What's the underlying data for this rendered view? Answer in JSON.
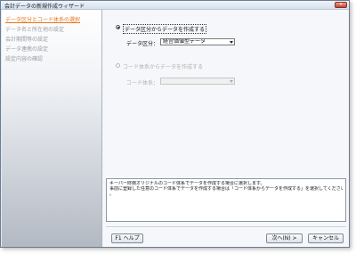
{
  "window": {
    "title": "会計データの新規作成ウィザード",
    "close_label": "×"
  },
  "sidebar": {
    "steps": [
      {
        "label": "データ区分とコード体系の選択"
      },
      {
        "label": "データ名と所在地の設定"
      },
      {
        "label": "会計期間等の設定"
      },
      {
        "label": "データ連携の設定"
      },
      {
        "label": "設定内容の確認"
      }
    ]
  },
  "main": {
    "option1": {
      "label": "データ区分からデータを作成する",
      "selected": true
    },
    "data_kind": {
      "label": "データ区分：",
      "value": "経営価値型データ"
    },
    "option2": {
      "label": "コード体系からデータを作成する",
      "selected": false
    },
    "code_system": {
      "label": "コード体系：",
      "value": ""
    },
    "info_lines": [
      "キーパー財務オリジナルのコード体系でデータを作成する場合に選択します。",
      "事前に登録した任意のコード体系でデータを作成する場合は「コード体系からデータを作成する」を選択してください",
      "。"
    ]
  },
  "buttons": {
    "help": "F1 ヘルプ",
    "next": "次へ(N) >",
    "cancel": "キャンセル"
  }
}
